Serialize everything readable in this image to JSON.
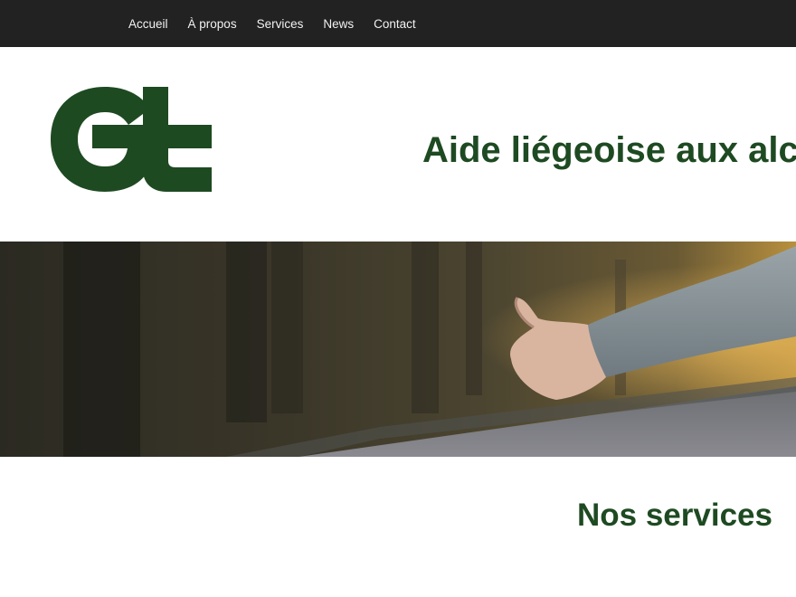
{
  "nav": {
    "items": [
      {
        "label": "Accueil"
      },
      {
        "label": "À propos"
      },
      {
        "label": "Services"
      },
      {
        "label": "News"
      },
      {
        "label": "Contact"
      }
    ]
  },
  "header": {
    "title": "Aide liégeoise aux alcoolique",
    "logo_icon": "alt-logo-icon"
  },
  "hero": {
    "image_icon": "hitchhiker-thumb-up-photo"
  },
  "main": {
    "section_title": "Nos services"
  },
  "colors": {
    "brand_green": "#1e4a22",
    "topbar": "#222222",
    "nav_text": "#f2f2f2",
    "background": "#ffffff"
  }
}
